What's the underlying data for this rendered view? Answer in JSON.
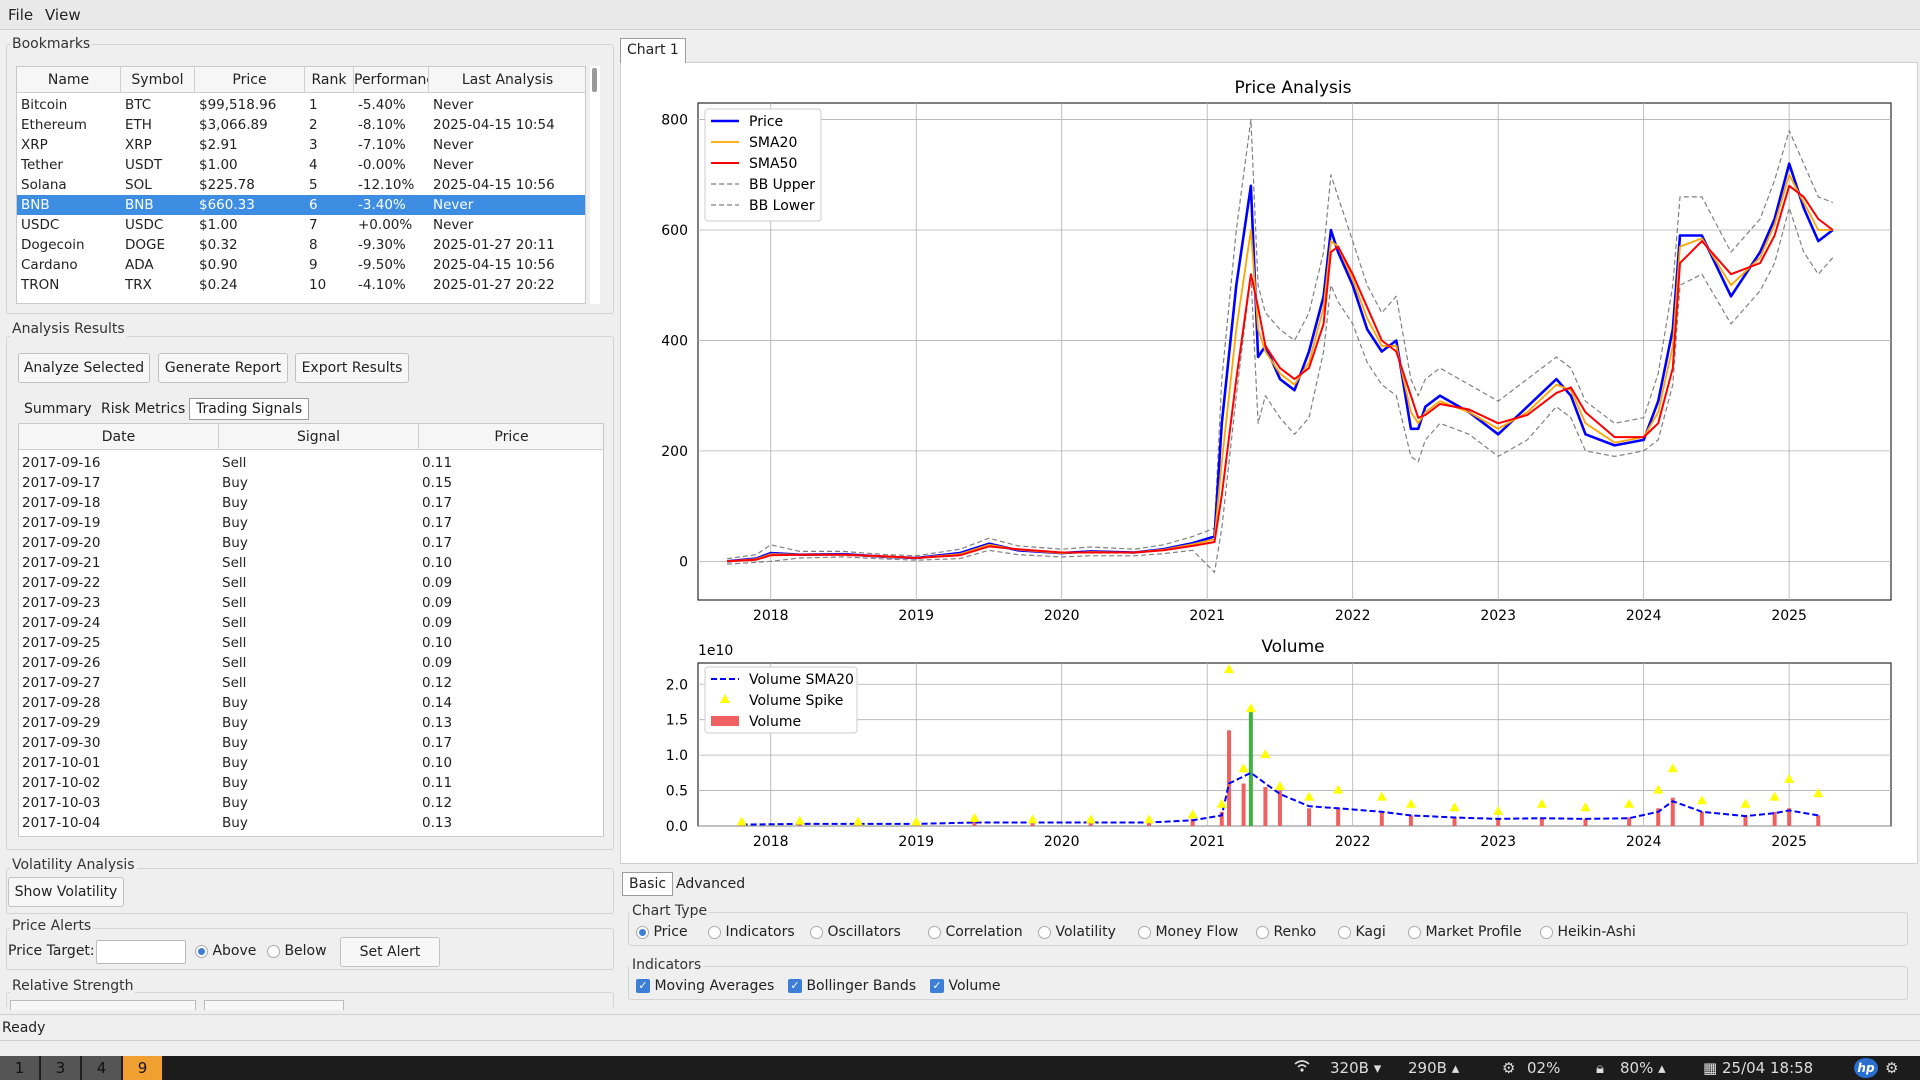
{
  "menu": {
    "file": "File",
    "view": "View"
  },
  "bookmarks": {
    "title": "Bookmarks",
    "columns": [
      "Name",
      "Symbol",
      "Price",
      "Rank",
      "Performanc",
      "Last Analysis"
    ],
    "rows": [
      [
        "Bitcoin",
        "BTC",
        "$99,518.96",
        "1",
        "-5.40%",
        "Never"
      ],
      [
        "Ethereum",
        "ETH",
        "$3,066.89",
        "2",
        "-8.10%",
        "2025-04-15 10:54"
      ],
      [
        "XRP",
        "XRP",
        "$2.91",
        "3",
        "-7.10%",
        "Never"
      ],
      [
        "Tether",
        "USDT",
        "$1.00",
        "4",
        "-0.00%",
        "Never"
      ],
      [
        "Solana",
        "SOL",
        "$225.78",
        "5",
        "-12.10%",
        "2025-04-15 10:56"
      ],
      [
        "BNB",
        "BNB",
        "$660.33",
        "6",
        "-3.40%",
        "Never"
      ],
      [
        "USDC",
        "USDC",
        "$1.00",
        "7",
        "+0.00%",
        "Never"
      ],
      [
        "Dogecoin",
        "DOGE",
        "$0.32",
        "8",
        "-9.30%",
        "2025-01-27 20:11"
      ],
      [
        "Cardano",
        "ADA",
        "$0.90",
        "9",
        "-9.50%",
        "2025-04-15 10:56"
      ],
      [
        "TRON",
        "TRX",
        "$0.24",
        "10",
        "-4.10%",
        "2025-01-27 20:22"
      ]
    ],
    "selected_row": "BNB"
  },
  "analysis": {
    "title": "Analysis Results",
    "buttons": {
      "analyze": "Analyze Selected",
      "report": "Generate Report",
      "export": "Export Results"
    },
    "tabs": [
      "Summary",
      "Risk Metrics",
      "Trading Signals"
    ],
    "active_tab": "Trading Signals",
    "columns": [
      "Date",
      "Signal",
      "Price"
    ],
    "signals": [
      [
        "2017-09-16",
        "Sell",
        "0.11"
      ],
      [
        "2017-09-17",
        "Buy",
        "0.15"
      ],
      [
        "2017-09-18",
        "Buy",
        "0.17"
      ],
      [
        "2017-09-19",
        "Buy",
        "0.17"
      ],
      [
        "2017-09-20",
        "Buy",
        "0.17"
      ],
      [
        "2017-09-21",
        "Sell",
        "0.10"
      ],
      [
        "2017-09-22",
        "Sell",
        "0.09"
      ],
      [
        "2017-09-23",
        "Sell",
        "0.09"
      ],
      [
        "2017-09-24",
        "Sell",
        "0.09"
      ],
      [
        "2017-09-25",
        "Sell",
        "0.10"
      ],
      [
        "2017-09-26",
        "Sell",
        "0.09"
      ],
      [
        "2017-09-27",
        "Sell",
        "0.12"
      ],
      [
        "2017-09-28",
        "Buy",
        "0.14"
      ],
      [
        "2017-09-29",
        "Buy",
        "0.13"
      ],
      [
        "2017-09-30",
        "Buy",
        "0.17"
      ],
      [
        "2017-10-01",
        "Buy",
        "0.10"
      ],
      [
        "2017-10-02",
        "Buy",
        "0.11"
      ],
      [
        "2017-10-03",
        "Buy",
        "0.12"
      ],
      [
        "2017-10-04",
        "Buy",
        "0.13"
      ]
    ]
  },
  "volatility": {
    "title": "Volatility Analysis",
    "button": "Show Volatility"
  },
  "alerts": {
    "title": "Price Alerts",
    "target_label": "Price Target:",
    "target_value": "",
    "above": "Above",
    "below": "Below",
    "set_button": "Set Alert",
    "selected": "Above"
  },
  "relative_strength": {
    "title": "Relative Strength"
  },
  "chart_tab": "Chart 1",
  "colors": {
    "price": "#0000ff",
    "sma20": "#ffa500",
    "sma50": "#ff0000",
    "bb": "#808080",
    "vol_sma": "#0000ff",
    "spike": "#ffff00",
    "volume": "#f06060",
    "volume_up": "#40b040",
    "selection": "#3d8ee2"
  },
  "chart_data": [
    {
      "type": "line",
      "title": "Price Analysis",
      "xlabel": "",
      "ylabel": "",
      "xlim": [
        2017.5,
        2025.7
      ],
      "ylim": [
        -70,
        830
      ],
      "xticks": [
        "2018",
        "2019",
        "2020",
        "2021",
        "2022",
        "2023",
        "2024",
        "2025"
      ],
      "yticks": [
        0,
        200,
        400,
        600,
        800
      ],
      "grid": true,
      "legend_position": "top-left",
      "x": [
        2017.7,
        2017.9,
        2018.0,
        2018.2,
        2018.5,
        2018.8,
        2019.0,
        2019.3,
        2019.5,
        2019.7,
        2020.0,
        2020.2,
        2020.5,
        2020.7,
        2020.9,
        2021.05,
        2021.1,
        2021.2,
        2021.3,
        2021.35,
        2021.4,
        2021.5,
        2021.6,
        2021.7,
        2021.8,
        2021.85,
        2021.9,
        2022.0,
        2022.1,
        2022.2,
        2022.3,
        2022.4,
        2022.45,
        2022.5,
        2022.6,
        2022.8,
        2023.0,
        2023.2,
        2023.4,
        2023.5,
        2023.6,
        2023.8,
        2024.0,
        2024.1,
        2024.2,
        2024.25,
        2024.4,
        2024.6,
        2024.8,
        2024.9,
        2025.0,
        2025.1,
        2025.2,
        2025.3
      ],
      "series": [
        {
          "name": "Price",
          "values": [
            0,
            5,
            15,
            12,
            13,
            8,
            6,
            15,
            32,
            20,
            15,
            18,
            16,
            22,
            33,
            45,
            250,
            500,
            680,
            370,
            390,
            330,
            310,
            380,
            480,
            600,
            560,
            500,
            420,
            380,
            400,
            240,
            240,
            280,
            300,
            270,
            230,
            280,
            330,
            300,
            230,
            210,
            220,
            290,
            420,
            590,
            590,
            480,
            560,
            620,
            720,
            640,
            580,
            600
          ]
        },
        {
          "name": "SMA20",
          "values": [
            0,
            4,
            13,
            12,
            12,
            8,
            6,
            13,
            30,
            21,
            15,
            17,
            16,
            21,
            31,
            40,
            180,
            420,
            600,
            420,
            380,
            340,
            320,
            360,
            460,
            580,
            570,
            510,
            440,
            390,
            390,
            270,
            250,
            270,
            290,
            270,
            240,
            270,
            320,
            310,
            250,
            215,
            225,
            270,
            390,
            570,
            585,
            500,
            550,
            610,
            700,
            650,
            600,
            600
          ]
        },
        {
          "name": "SMA50",
          "values": [
            0,
            3,
            11,
            12,
            12,
            9,
            6,
            11,
            27,
            22,
            16,
            16,
            16,
            20,
            28,
            35,
            120,
            330,
            520,
            460,
            390,
            350,
            330,
            350,
            430,
            560,
            570,
            520,
            460,
            400,
            380,
            300,
            260,
            265,
            285,
            275,
            250,
            265,
            305,
            315,
            270,
            225,
            225,
            250,
            350,
            540,
            580,
            520,
            540,
            590,
            680,
            660,
            620,
            600
          ]
        },
        {
          "name": "BB Upper",
          "values": [
            5,
            12,
            30,
            18,
            18,
            12,
            10,
            22,
            42,
            28,
            22,
            26,
            22,
            30,
            45,
            60,
            330,
            600,
            800,
            500,
            450,
            420,
            400,
            450,
            560,
            700,
            660,
            580,
            500,
            450,
            480,
            330,
            300,
            330,
            350,
            320,
            290,
            330,
            370,
            350,
            290,
            250,
            260,
            340,
            500,
            660,
            660,
            560,
            620,
            690,
            780,
            720,
            660,
            650
          ]
        },
        {
          "name": "BB Lower",
          "values": [
            -5,
            -2,
            0,
            6,
            8,
            4,
            2,
            5,
            20,
            12,
            8,
            10,
            10,
            14,
            20,
            -20,
            60,
            300,
            520,
            250,
            300,
            260,
            230,
            260,
            380,
            500,
            470,
            430,
            360,
            320,
            300,
            190,
            180,
            220,
            250,
            230,
            190,
            220,
            280,
            260,
            200,
            190,
            200,
            220,
            320,
            500,
            520,
            430,
            490,
            540,
            640,
            560,
            520,
            550
          ]
        }
      ]
    },
    {
      "type": "bar",
      "title": "Volume",
      "xlabel": "",
      "ylabel": "",
      "scale_label": "1e10",
      "xlim": [
        2017.5,
        2025.7
      ],
      "ylim": [
        0,
        2.3
      ],
      "xticks": [
        "2018",
        "2019",
        "2020",
        "2021",
        "2022",
        "2023",
        "2024",
        "2025"
      ],
      "yticks": [
        "0.0",
        "0.5",
        "1.0",
        "1.5",
        "2.0"
      ],
      "grid": true,
      "legend_position": "top-left",
      "x": [
        2017.8,
        2018.2,
        2018.6,
        2019.0,
        2019.4,
        2019.8,
        2020.2,
        2020.6,
        2020.9,
        2021.1,
        2021.15,
        2021.25,
        2021.3,
        2021.4,
        2021.5,
        2021.7,
        2021.9,
        2022.2,
        2022.4,
        2022.7,
        2023.0,
        2023.3,
        2023.6,
        2023.9,
        2024.1,
        2024.2,
        2024.4,
        2024.7,
        2024.9,
        2025.0,
        2025.2
      ],
      "series": [
        {
          "name": "Volume",
          "values": [
            0.02,
            0.03,
            0.03,
            0.03,
            0.06,
            0.05,
            0.05,
            0.05,
            0.1,
            0.2,
            1.35,
            0.6,
            1.65,
            0.55,
            0.5,
            0.25,
            0.25,
            0.2,
            0.15,
            0.12,
            0.1,
            0.12,
            0.1,
            0.12,
            0.25,
            0.4,
            0.2,
            0.15,
            0.2,
            0.25,
            0.15
          ]
        },
        {
          "name": "Volume SMA20",
          "values": [
            0.02,
            0.03,
            0.03,
            0.03,
            0.05,
            0.05,
            0.05,
            0.05,
            0.08,
            0.15,
            0.6,
            0.7,
            0.75,
            0.6,
            0.45,
            0.28,
            0.25,
            0.2,
            0.15,
            0.12,
            0.1,
            0.11,
            0.1,
            0.11,
            0.2,
            0.35,
            0.2,
            0.14,
            0.18,
            0.22,
            0.15
          ]
        },
        {
          "name": "Volume Spike",
          "values": [
            0.05,
            0.06,
            0.05,
            0.05,
            0.1,
            0.08,
            0.08,
            0.08,
            0.15,
            0.3,
            2.2,
            0.8,
            1.65,
            1.0,
            0.55,
            0.4,
            0.5,
            0.4,
            0.3,
            0.25,
            0.2,
            0.3,
            0.25,
            0.3,
            0.5,
            0.8,
            0.35,
            0.3,
            0.4,
            0.65,
            0.45
          ]
        }
      ]
    }
  ],
  "chart_legend": {
    "price": [
      "Price",
      "SMA20",
      "SMA50",
      "BB Upper",
      "BB Lower"
    ],
    "volume": [
      "Volume SMA20",
      "Volume Spike",
      "Volume"
    ]
  },
  "bottom_tabs": [
    "Basic",
    "Advanced"
  ],
  "chart_type": {
    "title": "Chart Type",
    "options": [
      "Price",
      "Indicators",
      "Oscillators",
      "Correlation",
      "Volatility",
      "Money Flow",
      "Renko",
      "Kagi",
      "Market Profile",
      "Heikin-Ashi"
    ],
    "selected": "Price"
  },
  "indicators": {
    "title": "Indicators",
    "options": [
      "Moving Averages",
      "Bollinger Bands",
      "Volume"
    ]
  },
  "status": "Ready",
  "taskbar": {
    "workspaces": [
      "1",
      "3",
      "4",
      "9"
    ],
    "active_workspace": "9",
    "net_down": "320B",
    "net_up": "290B",
    "cpu": "02%",
    "battery": "80%",
    "datetime": "25/04 18:58",
    "wifi_icon": "wifi-icon",
    "cpu_icon": "cpu-icon",
    "lock_icon": "lock-icon",
    "calendar_icon": "calendar-icon"
  }
}
